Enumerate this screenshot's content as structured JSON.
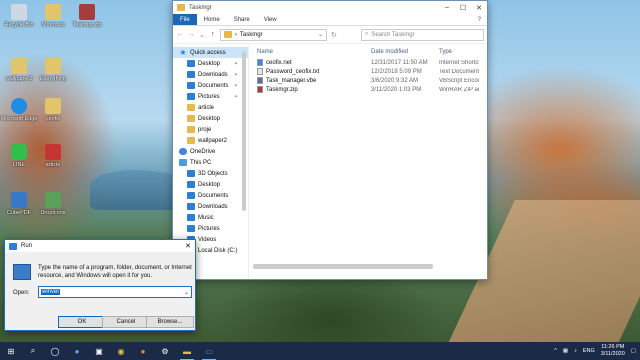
{
  "desktop": {
    "icons": [
      {
        "label": "Recycle Bin",
        "color": "#cfd8e0"
      },
      {
        "label": "Shortcuts",
        "color": "#e2c46a"
      },
      {
        "label": "Taskmgr.zip",
        "color": "#a83c3c"
      },
      {
        "label": "wallpaper2",
        "color": "#e2c46a"
      },
      {
        "label": "Everything",
        "color": "#e2c46a"
      },
      {
        "label": "Microsoft Edge",
        "color": "#1d8de6"
      },
      {
        "label": "ceofix",
        "color": "#e2c46a"
      },
      {
        "label": "LINE",
        "color": "#2fbf4a"
      },
      {
        "label": "article",
        "color": "#c63434"
      },
      {
        "label": "CubePDF",
        "color": "#3878c8"
      },
      {
        "label": "DropIcons",
        "color": "#5aa25a"
      }
    ]
  },
  "explorer": {
    "title": "Taskmgr",
    "tabs": [
      "File",
      "Home",
      "Share",
      "View"
    ],
    "address": "Taskmgr",
    "search_placeholder": "Search Taskmgr",
    "nav": [
      {
        "label": "Quick access",
        "icon": "star-icon",
        "top": true,
        "sel": true
      },
      {
        "label": "Desktop",
        "icon": "desktop-icon",
        "pin": true
      },
      {
        "label": "Downloads",
        "icon": "download-icon",
        "pin": true
      },
      {
        "label": "Documents",
        "icon": "documents-icon",
        "pin": true
      },
      {
        "label": "Pictures",
        "icon": "pictures-icon",
        "pin": true
      },
      {
        "label": "article",
        "icon": "folder-icon"
      },
      {
        "label": "Desktop",
        "icon": "folder-icon"
      },
      {
        "label": "proje",
        "icon": "folder-icon"
      },
      {
        "label": "wallpaper2",
        "icon": "folder-icon"
      },
      {
        "label": "OneDrive",
        "icon": "cloud-icon",
        "top": true
      },
      {
        "label": "This PC",
        "icon": "pc-icon",
        "top": true
      },
      {
        "label": "3D Objects",
        "icon": "cube-icon"
      },
      {
        "label": "Desktop",
        "icon": "desktop-icon"
      },
      {
        "label": "Documents",
        "icon": "documents-icon"
      },
      {
        "label": "Downloads",
        "icon": "download-icon"
      },
      {
        "label": "Music",
        "icon": "music-icon"
      },
      {
        "label": "Pictures",
        "icon": "pictures-icon"
      },
      {
        "label": "Videos",
        "icon": "videos-icon"
      },
      {
        "label": "Local Disk (C:)",
        "icon": "drive-icon"
      }
    ],
    "columns": {
      "name": "Name",
      "date": "Date modified",
      "type": "Type"
    },
    "files": [
      {
        "name": "ceofix.net",
        "date": "12/31/2017 11:50 AM",
        "type": "Internet Shortcut",
        "color": "#3b87e8"
      },
      {
        "name": "Password_ceofix.txt",
        "date": "12/2/2018 5:09 PM",
        "type": "Text Document",
        "color": "#e6e6e6"
      },
      {
        "name": "Task_manager.vbe",
        "date": "3/6/2020 9:32 AM",
        "type": "VBScript Encoded",
        "color": "#6a6a9a"
      },
      {
        "name": "Taskmgr.zip",
        "date": "3/11/2020 1:03 PM",
        "type": "WinRAR ZIP archive",
        "color": "#a83c3c"
      }
    ]
  },
  "run": {
    "title": "Run",
    "description": "Type the name of a program, folder, document, or Internet resource, and Windows will open it for you.",
    "open_label": "Open:",
    "input_value": "winver",
    "ok": "OK",
    "cancel": "Cancel",
    "browse": "Browse..."
  },
  "taskbar": {
    "lang": "ENG",
    "time": "11:26 PM",
    "date": "3/11/2020"
  }
}
